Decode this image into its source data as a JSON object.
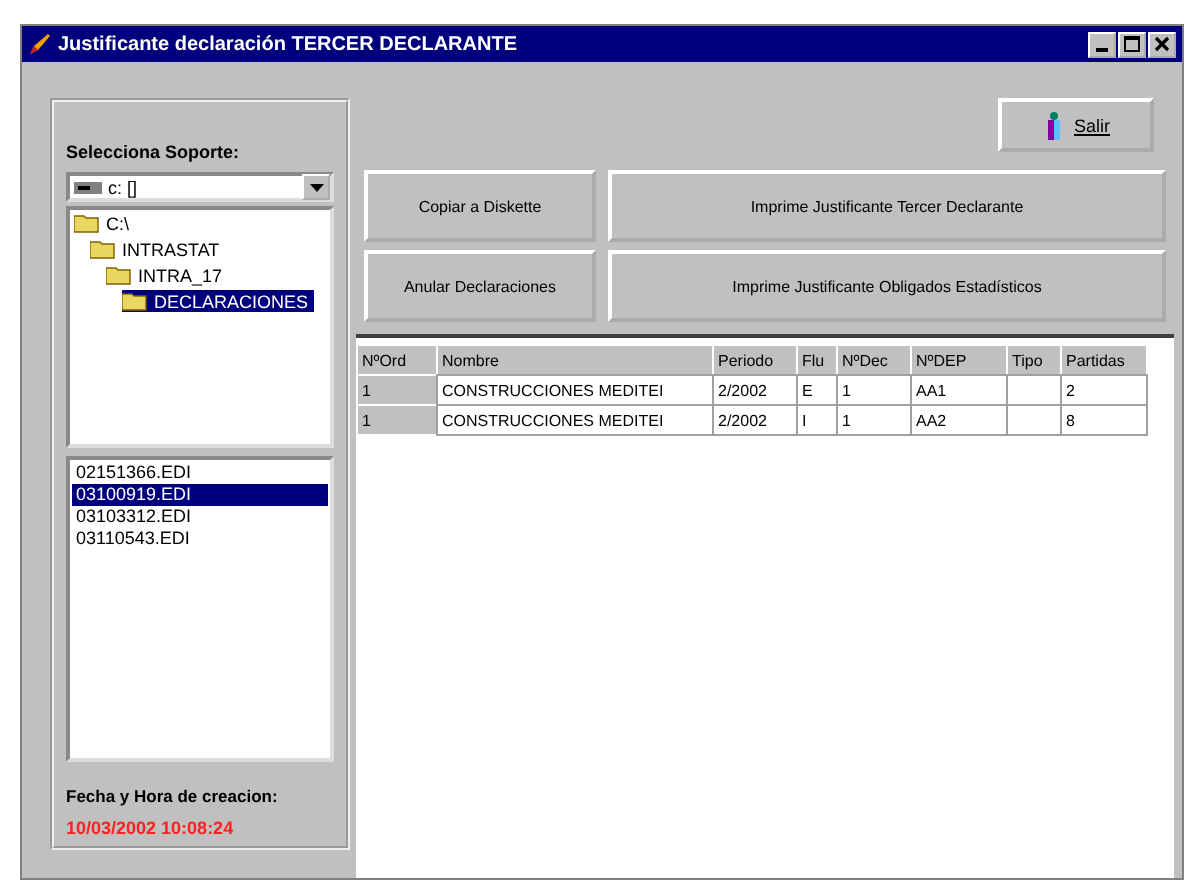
{
  "window": {
    "title": "Justificante declaración TERCER DECLARANTE"
  },
  "support": {
    "label": "Selecciona Soporte:",
    "drive": "c: []",
    "folders": [
      {
        "label": "C:\\",
        "selected": false,
        "children": [
          {
            "label": "INTRASTAT",
            "selected": false,
            "children": [
              {
                "label": "INTRA_17",
                "selected": false,
                "children": [
                  {
                    "label": "DECLARACIONES",
                    "selected": true
                  }
                ]
              }
            ]
          }
        ]
      }
    ],
    "files": [
      {
        "label": "02151366.EDI",
        "selected": false
      },
      {
        "label": "03100919.EDI",
        "selected": true
      },
      {
        "label": "03103312.EDI",
        "selected": false
      },
      {
        "label": "03110543.EDI",
        "selected": false
      }
    ],
    "created_label": "Fecha y Hora de creacion:",
    "created_value": "10/03/2002 10:08:24"
  },
  "exit_button": "Salir",
  "buttons": [
    "Copiar a Diskette",
    "Anular Declaraciones",
    "Imprime  Justificante Tercer Declarante",
    "Imprime  Justificante Obligados Estadísticos"
  ],
  "table": {
    "columns": [
      "NºOrd",
      "Nombre",
      "Periodo",
      "Flu",
      "NºDec",
      "NºDEP",
      "Tipo",
      "Partidas"
    ],
    "rows": [
      [
        "1",
        "CONSTRUCCIONES MEDITEI",
        "2/2002",
        "E",
        "1",
        "AA1",
        "",
        "2"
      ],
      [
        "1",
        "CONSTRUCCIONES MEDITEI",
        "2/2002",
        "I",
        "1",
        "AA2",
        "",
        "8"
      ]
    ]
  }
}
